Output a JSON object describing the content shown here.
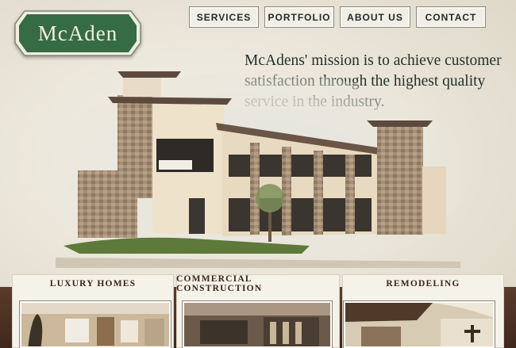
{
  "logo": {
    "text": "McAden"
  },
  "nav": {
    "items": [
      {
        "label": "SERVICES"
      },
      {
        "label": "PORTFOLIO"
      },
      {
        "label": "ABOUT US"
      },
      {
        "label": "CONTACT"
      }
    ]
  },
  "mission": {
    "text": "McAdens' mission is to achieve customer satisfaction through the highest quality service in the industry."
  },
  "categories": [
    {
      "label": "LUXURY HOMES"
    },
    {
      "label": "COMMERCIAL CONSTRUCTION"
    },
    {
      "label": "REMODELING"
    }
  ],
  "colors": {
    "logo_green": "#356b45",
    "text_dark": "#22322a",
    "card_heading": "#3b2418",
    "bottom_band": "#4c3123"
  }
}
